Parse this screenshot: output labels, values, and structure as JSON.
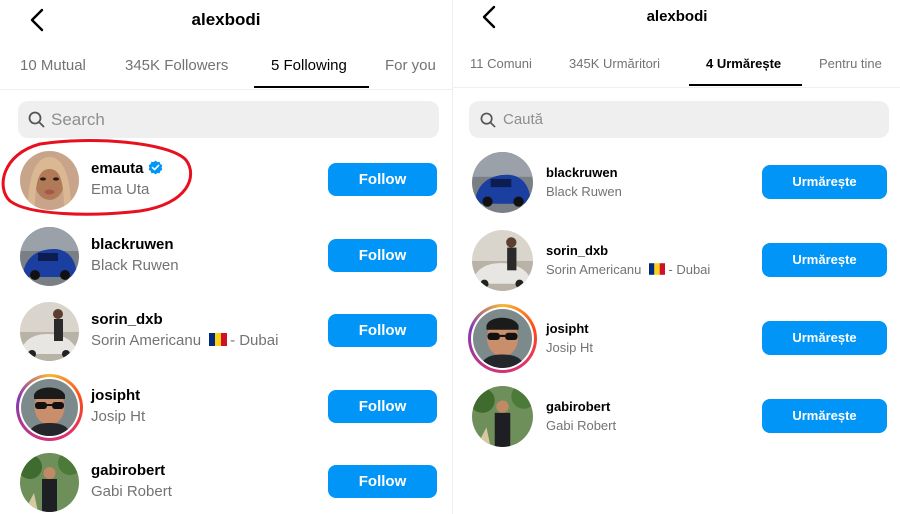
{
  "left": {
    "title": "alexbodi",
    "tabs": [
      "10 Mutual",
      "345K Followers",
      "5 Following",
      "For you"
    ],
    "search_placeholder": "Search",
    "users": [
      {
        "username": "emauta",
        "name": "Ema Uta",
        "button": "Follow"
      },
      {
        "username": "blackruwen",
        "name": "Black Ruwen",
        "button": "Follow"
      },
      {
        "username": "sorin_dxb",
        "name": "Sorin Americanu",
        "location": "- Dubai",
        "button": "Follow"
      },
      {
        "username": "josipht",
        "name": "Josip Ht",
        "button": "Follow"
      },
      {
        "username": "gabirobert",
        "name": "Gabi Robert",
        "button": "Follow"
      }
    ]
  },
  "right": {
    "title": "alexbodi",
    "tabs": [
      "11 Comuni",
      "345K Urmăritori",
      "4 Urmărește",
      "Pentru tine"
    ],
    "search_placeholder": "Caută",
    "users": [
      {
        "username": "blackruwen",
        "name": "Black Ruwen",
        "button": "Urmărește"
      },
      {
        "username": "sorin_dxb",
        "name": "Sorin Americanu",
        "location": "- Dubai",
        "button": "Urmărește"
      },
      {
        "username": "josipht",
        "name": "Josip Ht",
        "button": "Urmărește"
      },
      {
        "username": "gabirobert",
        "name": "Gabi Robert",
        "button": "Urmărește"
      }
    ]
  },
  "colors": {
    "follow_button": "#0095f6",
    "highlight_circle": "#e8101f",
    "verified": "#0095f6"
  }
}
